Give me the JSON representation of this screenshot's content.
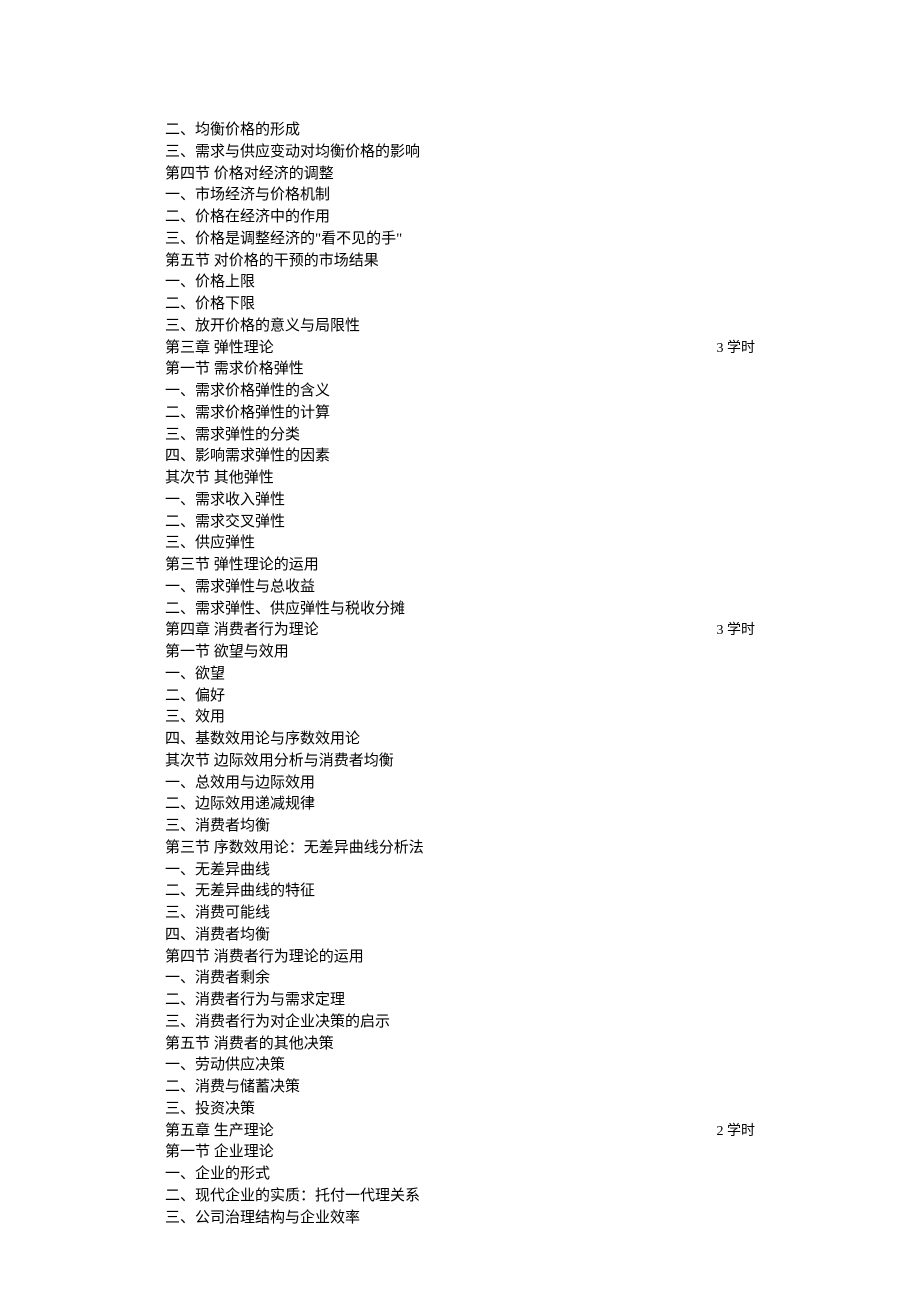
{
  "lines": [
    {
      "text": "二、均衡价格的形成",
      "hours": ""
    },
    {
      "text": "三、需求与供应变动对均衡价格的影响",
      "hours": ""
    },
    {
      "text": "第四节  价格对经济的调整",
      "hours": ""
    },
    {
      "text": "一、市场经济与价格机制",
      "hours": ""
    },
    {
      "text": "二、价格在经济中的作用",
      "hours": ""
    },
    {
      "text": "三、价格是调整经济的\"看不见的手\"",
      "hours": ""
    },
    {
      "text": "第五节  对价格的干预的市场结果",
      "hours": ""
    },
    {
      "text": "一、价格上限",
      "hours": ""
    },
    {
      "text": "二、价格下限",
      "hours": ""
    },
    {
      "text": "三、放开价格的意义与局限性",
      "hours": ""
    },
    {
      "text": "第三章  弹性理论",
      "hours": "3 学时"
    },
    {
      "text": "第一节  需求价格弹性",
      "hours": ""
    },
    {
      "text": "一、需求价格弹性的含义",
      "hours": ""
    },
    {
      "text": "二、需求价格弹性的计算",
      "hours": ""
    },
    {
      "text": "三、需求弹性的分类",
      "hours": ""
    },
    {
      "text": "四、影响需求弹性的因素",
      "hours": ""
    },
    {
      "text": "其次节  其他弹性",
      "hours": ""
    },
    {
      "text": "一、需求收入弹性",
      "hours": ""
    },
    {
      "text": "二、需求交叉弹性",
      "hours": ""
    },
    {
      "text": "三、供应弹性",
      "hours": ""
    },
    {
      "text": "第三节  弹性理论的运用",
      "hours": ""
    },
    {
      "text": "一、需求弹性与总收益",
      "hours": ""
    },
    {
      "text": "二、需求弹性、供应弹性与税收分摊",
      "hours": ""
    },
    {
      "text": "第四章  消费者行为理论",
      "hours": "3 学时"
    },
    {
      "text": "第一节  欲望与效用",
      "hours": ""
    },
    {
      "text": "一、欲望",
      "hours": ""
    },
    {
      "text": "二、偏好",
      "hours": ""
    },
    {
      "text": "三、效用",
      "hours": ""
    },
    {
      "text": "四、基数效用论与序数效用论",
      "hours": ""
    },
    {
      "text": "其次节  边际效用分析与消费者均衡",
      "hours": ""
    },
    {
      "text": "一、总效用与边际效用",
      "hours": ""
    },
    {
      "text": "二、边际效用递减规律",
      "hours": ""
    },
    {
      "text": "三、消费者均衡",
      "hours": ""
    },
    {
      "text": "第三节  序数效用论：无差异曲线分析法",
      "hours": ""
    },
    {
      "text": "一、无差异曲线",
      "hours": ""
    },
    {
      "text": "二、无差异曲线的特征",
      "hours": ""
    },
    {
      "text": "三、消费可能线",
      "hours": ""
    },
    {
      "text": "四、消费者均衡",
      "hours": ""
    },
    {
      "text": "第四节  消费者行为理论的运用",
      "hours": ""
    },
    {
      "text": "一、消费者剩余",
      "hours": ""
    },
    {
      "text": "二、消费者行为与需求定理",
      "hours": ""
    },
    {
      "text": "三、消费者行为对企业决策的启示",
      "hours": ""
    },
    {
      "text": "第五节  消费者的其他决策",
      "hours": ""
    },
    {
      "text": "一、劳动供应决策",
      "hours": ""
    },
    {
      "text": "二、消费与储蓄决策",
      "hours": ""
    },
    {
      "text": "三、投资决策",
      "hours": ""
    },
    {
      "text": "第五章  生产理论",
      "hours": "2 学时"
    },
    {
      "text": "第一节  企业理论",
      "hours": ""
    },
    {
      "text": "一、企业的形式",
      "hours": ""
    },
    {
      "text": "二、现代企业的实质：托付一代理关系",
      "hours": ""
    },
    {
      "text": "三、公司治理结构与企业效率",
      "hours": ""
    }
  ]
}
